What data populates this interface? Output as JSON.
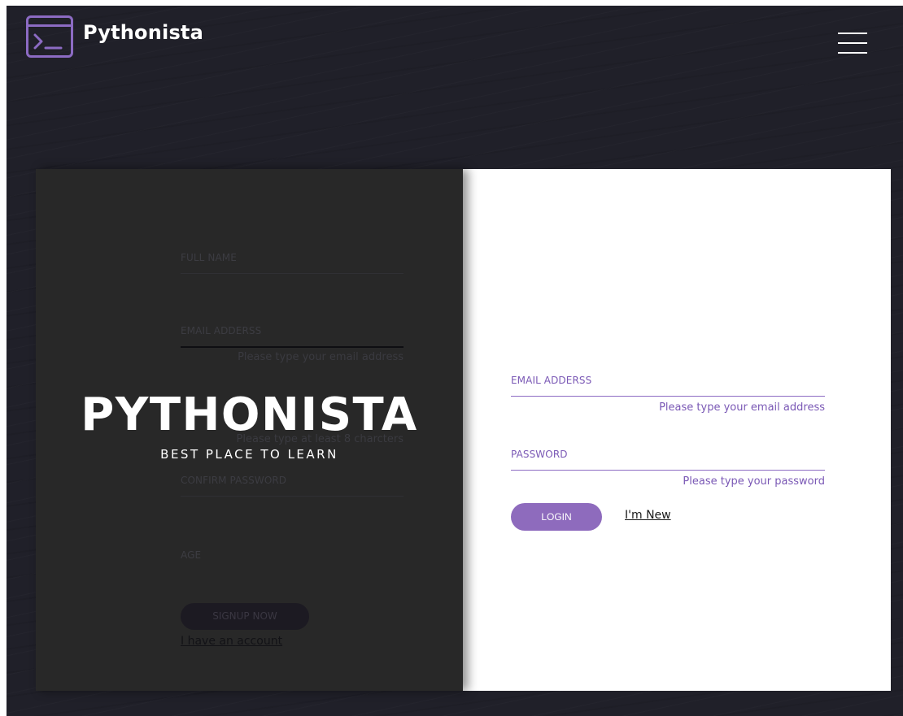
{
  "header": {
    "brand": "Pythonista",
    "menu_icon": "hamburger-menu-icon",
    "logo_icon": "terminal-icon"
  },
  "overlay": {
    "title": "PYTHONISTA",
    "subtitle": "BEST PLACE TO LEARN"
  },
  "signup": {
    "full_name_label": "FULL NAME",
    "email_label": "EMAIL ADDERSS",
    "email_hint": "Please type your email address",
    "password_hint": "Please type at least 8 charcters",
    "confirm_password_label": "CONFIRM PASSWORD",
    "age_label": "AGE",
    "signup_button": "SIGNUP NOW",
    "have_account_link": "I have an account"
  },
  "login": {
    "email_label": "EMAIL ADDERSS",
    "email_hint": "Please type your email address",
    "password_label": "PASSWORD",
    "password_hint": "Please type your password",
    "login_button": "LOGIN",
    "new_user_link": "I'm New"
  },
  "colors": {
    "background": "#202029",
    "accent": "#8c6bc3",
    "signup_panel": "#282828",
    "login_panel": "#ffffff"
  }
}
